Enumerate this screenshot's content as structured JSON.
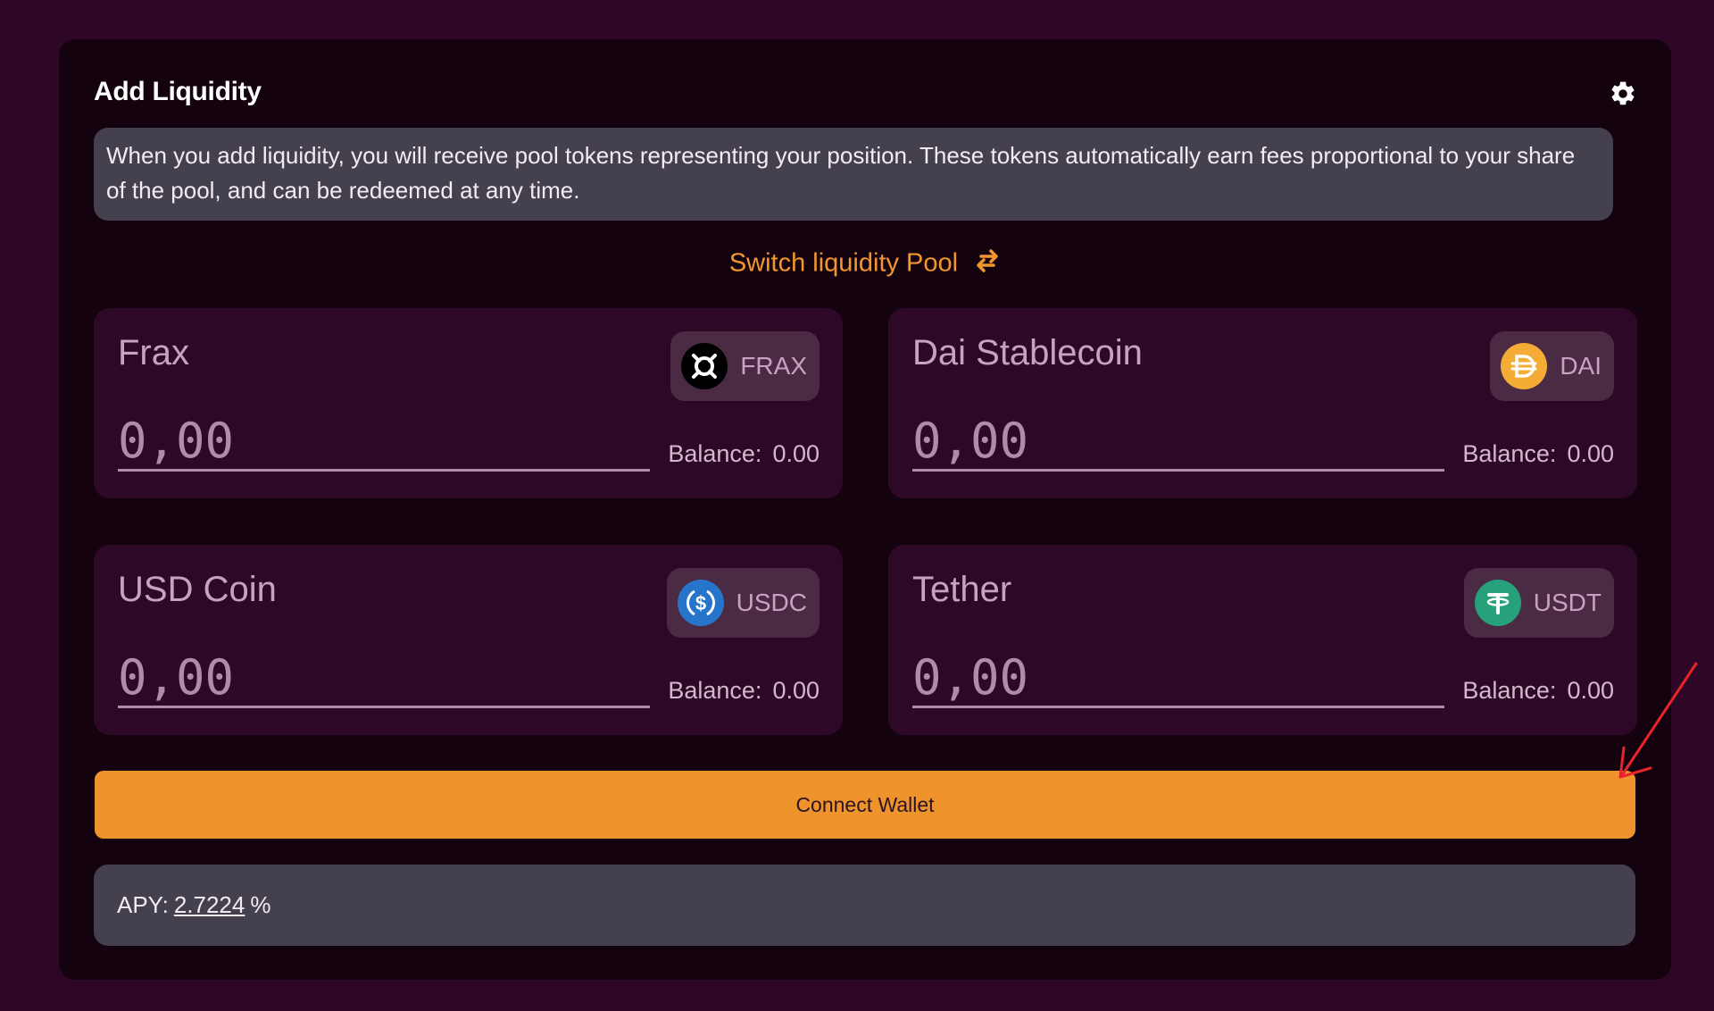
{
  "panel": {
    "title": "Add Liquidity",
    "settings_icon": "gear-icon",
    "notice": "When you add liquidity, you will receive pool tokens representing your position. These tokens automatically earn fees proportional to your share of the pool, and can be redeemed at any time.",
    "switch_label": "Switch liquidity Pool",
    "switch_icon": "swap-arrows-icon"
  },
  "tokens": [
    {
      "name": "Frax",
      "symbol": "FRAX",
      "placeholder": "0,00",
      "balance_label": "Balance:",
      "balance": "0.00",
      "icon": "frax-logo-icon",
      "color": "#000000"
    },
    {
      "name": "Dai Stablecoin",
      "symbol": "DAI",
      "placeholder": "0,00",
      "balance_label": "Balance:",
      "balance": "0.00",
      "icon": "dai-logo-icon",
      "color": "#f5ac37"
    },
    {
      "name": "USD Coin",
      "symbol": "USDC",
      "placeholder": "0,00",
      "balance_label": "Balance:",
      "balance": "0.00",
      "icon": "usdc-logo-icon",
      "color": "#2775ca"
    },
    {
      "name": "Tether",
      "symbol": "USDT",
      "placeholder": "0,00",
      "balance_label": "Balance:",
      "balance": "0.00",
      "icon": "usdt-logo-icon",
      "color": "#26a17b"
    }
  ],
  "actions": {
    "connect_label": "Connect Wallet"
  },
  "apy": {
    "label": "APY:",
    "value": "2.7224",
    "unit": "%"
  },
  "colors": {
    "background": "#2e0726",
    "panel": "#14020f",
    "accent": "#ef932d",
    "card": "#2e0927",
    "annotation": "#e8242a"
  }
}
